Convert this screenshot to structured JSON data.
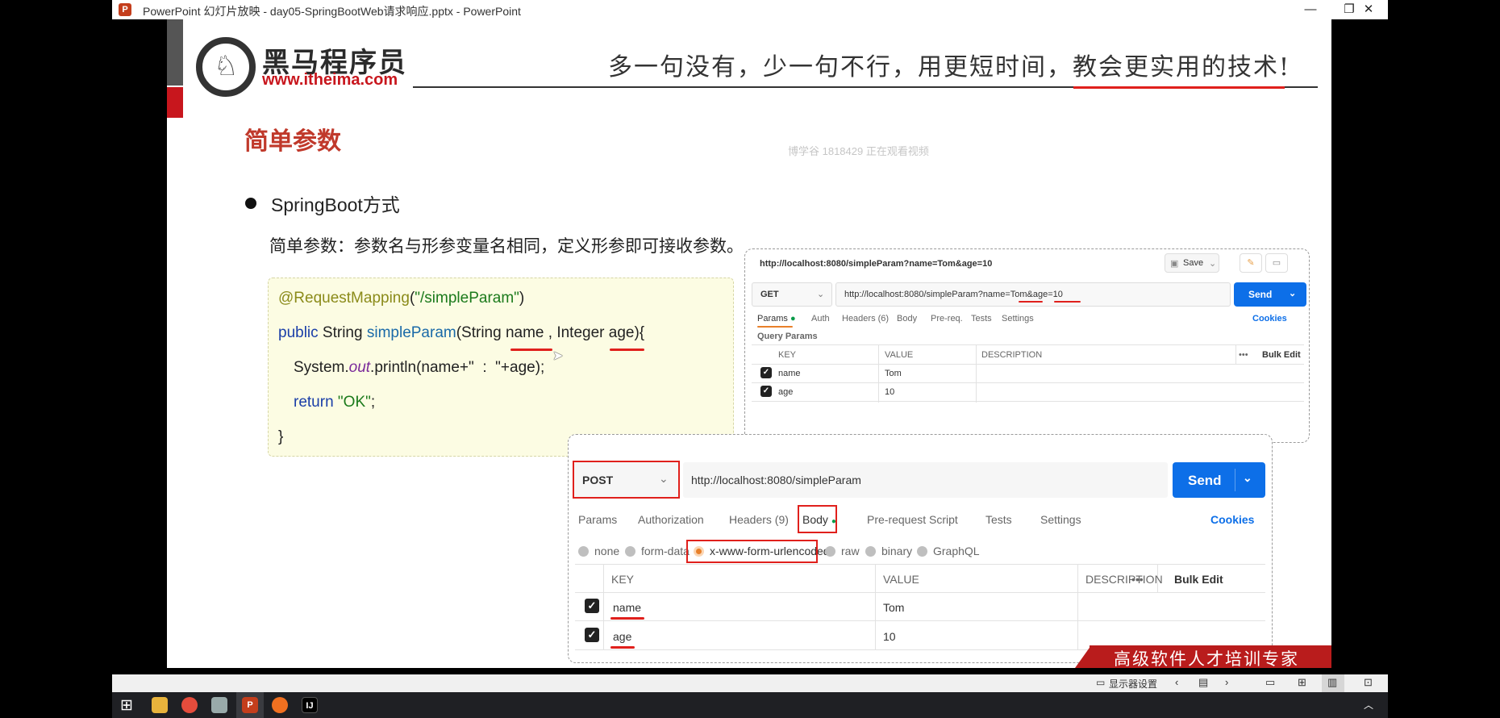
{
  "window": {
    "title": "PowerPoint 幻灯片放映  -  day05-SpringBootWeb请求响应.pptx  -  PowerPoint",
    "app_icon": "P",
    "minimize": "—",
    "maximize": "❐",
    "close": "✕"
  },
  "slide": {
    "brand_cn": "黑马程序员",
    "brand_url": "www.itheima.com",
    "slogan": "多一句没有，少一句不行，用更短时间，教会更实用的技术!",
    "title": "简单参数",
    "watermark": "博学谷 1818429 正在观看视频",
    "bullet": "SpringBoot方式",
    "description": "简单参数：参数名与形参变量名相同，定义形参即可接收参数。",
    "footer": "高级软件人才培训专家"
  },
  "code": {
    "annotation": "@RequestMapping",
    "mapping_open": "(",
    "mapping_path": "\"/simpleParam\"",
    "mapping_close": ")",
    "kw_public": "public",
    "type_string": " String ",
    "method_name": "simpleParam",
    "params": "(String name , Integer age){",
    "print_prefix": "System.",
    "print_out": "out",
    "print_suffix": ".println(name+\"  :  \"+age);",
    "kw_return": "return ",
    "return_value": "\"OK\"",
    "return_end": ";",
    "close_brace": "}"
  },
  "postman_get": {
    "header_url": "http://localhost:8080/simpleParam?name=Tom&age=10",
    "save": "Save",
    "method": "GET",
    "url": "http://localhost:8080/simpleParam?name=Tom&age=10",
    "send": "Send",
    "tabs": [
      "Params",
      "Auth",
      "Headers (6)",
      "Body",
      "Pre-req.",
      "Tests",
      "Settings"
    ],
    "cookies": "Cookies",
    "query_params_label": "Query Params",
    "columns": [
      "KEY",
      "VALUE",
      "DESCRIPTION"
    ],
    "more": "•••",
    "bulk_edit": "Bulk Edit",
    "rows": [
      {
        "key": "name",
        "value": "Tom"
      },
      {
        "key": "age",
        "value": "10"
      }
    ]
  },
  "postman_post": {
    "method": "POST",
    "url": "http://localhost:8080/simpleParam",
    "send": "Send",
    "tabs": [
      "Params",
      "Authorization",
      "Headers (9)",
      "Body",
      "Pre-request Script",
      "Tests",
      "Settings"
    ],
    "cookies": "Cookies",
    "body_types": [
      "none",
      "form-data",
      "x-www-form-urlencoded",
      "raw",
      "binary",
      "GraphQL"
    ],
    "columns": [
      "KEY",
      "VALUE",
      "DESCRIPTION"
    ],
    "more": "•••",
    "bulk_edit": "Bulk Edit",
    "rows": [
      {
        "key": "name",
        "value": "Tom"
      },
      {
        "key": "age",
        "value": "10"
      }
    ]
  },
  "statusbar": {
    "display_settings": "显示器设置"
  },
  "colors": {
    "accent_red": "#e0201c",
    "send_blue": "#0d6fe8",
    "code_bg": "#fcfce3"
  }
}
